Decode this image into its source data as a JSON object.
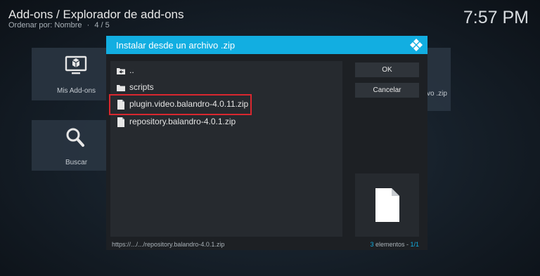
{
  "header": {
    "title": "Add-ons / Explorador de add-ons",
    "sort_label": "Ordenar por: Nombre",
    "separator": "·",
    "page": "4 / 5",
    "clock": "7:57 PM"
  },
  "background": {
    "tiles": [
      {
        "label": "Mis Add-ons",
        "icon": "addon-box-icon"
      },
      {
        "label": "Buscar",
        "icon": "search-icon"
      }
    ],
    "right_partial_text": "vo .zip"
  },
  "dialog": {
    "title": "Instalar desde un archivo .zip",
    "logo": "kodi-logo-icon",
    "accent_color": "#12aee1",
    "items": [
      {
        "name": "..",
        "icon": "parent-folder-icon"
      },
      {
        "name": "scripts",
        "icon": "folder-icon"
      },
      {
        "name": "plugin.video.balandro-4.0.11.zip",
        "icon": "file-icon"
      },
      {
        "name": "repository.balandro-4.0.1.zip",
        "icon": "file-icon"
      }
    ],
    "buttons": {
      "ok": "OK",
      "cancel": "Cancelar"
    },
    "preview_icon": "file-icon",
    "footer": {
      "path": "https://.../.../repository.balandro-4.0.1.zip",
      "count_number": "3",
      "count_label": " elementos - ",
      "pages": "1/1"
    },
    "highlight_color": "#d9272f"
  }
}
